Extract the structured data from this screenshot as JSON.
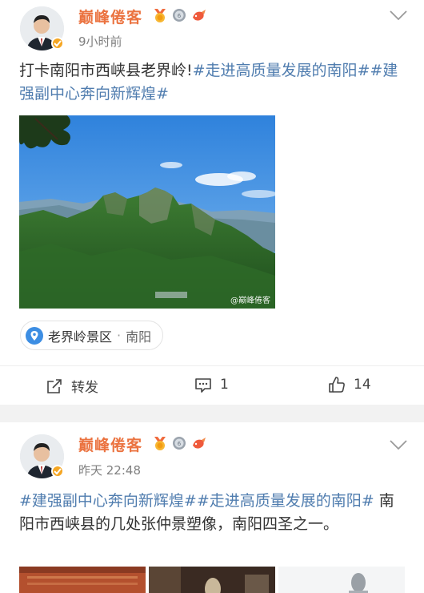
{
  "posts": [
    {
      "username": "巅峰倦客",
      "time": "9小时前",
      "text_plain": "打卡南阳市西峡县老界岭!",
      "hashtag_1": "#走进高质量发展的南阳#",
      "hashtag_2": "#建强副中心奔向新辉煌#",
      "photo_watermark": "@巅峰倦客",
      "location": {
        "name": "老界岭景区",
        "separator": "·",
        "city": "南阳"
      },
      "actions": {
        "repost_label": "转发",
        "comments": "1",
        "likes": "14"
      }
    },
    {
      "username": "巅峰倦客",
      "time": "昨天 22:48",
      "hashtag_1": "#建强副中心奔向新辉煌#",
      "hashtag_2": "#走进高质量发展的南阳#",
      "text_plain": "南阳市西峡县的几处张仲景塑像，南阳四圣之一。"
    }
  ],
  "badges": [
    "medal-badge-icon",
    "silver-medal-badge-icon",
    "koi-fish-badge-icon"
  ],
  "colors": {
    "username": "#eb7340",
    "hashtag": "#507daf",
    "verify": "#f5a623",
    "location_pin": "#3d8ee3"
  }
}
